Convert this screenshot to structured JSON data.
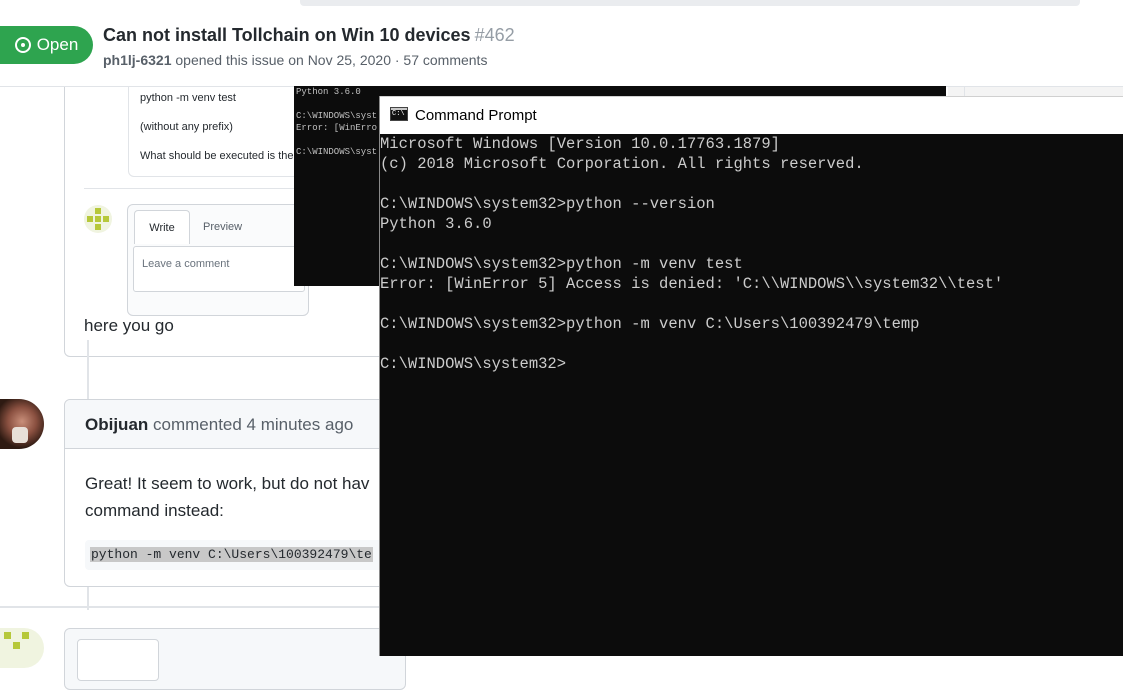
{
  "issue": {
    "state": "Open",
    "title": "Can not install Tollchain on Win 10 devices",
    "number": "#462",
    "author": "ph1lj-6321",
    "meta": "opened this issue on Nov 25, 2020 · 57 comments"
  },
  "previous_comment": {
    "lines": [
      "python -m venv test",
      "(without any prefix)",
      "What should be executed is the"
    ],
    "tabs": [
      "Write",
      "Preview"
    ],
    "comment_placeholder": "Leave a comment",
    "reply_text": "here you go"
  },
  "comment": {
    "author": "Obijuan",
    "action": "commented 4 minutes ago",
    "body_lines": [
      "Great! It seem to work, but do not hav",
      "command instead:"
    ],
    "code": "python -m venv C:\\Users\\100392479\\te"
  },
  "background_console": {
    "lines": [
      "Python 3.6.0",
      "",
      "C:\\WINDOWS\\syst",
      "Error: [WinErro",
      "",
      "C:\\WINDOWS\\syst"
    ]
  },
  "cmd": {
    "title": "Command Prompt",
    "lines": [
      "Microsoft Windows [Version 10.0.17763.1879]",
      "(c) 2018 Microsoft Corporation. All rights reserved.",
      "",
      "C:\\WINDOWS\\system32>python --version",
      "Python 3.6.0",
      "",
      "C:\\WINDOWS\\system32>python -m venv test",
      "Error: [WinError 5] Access is denied: 'C:\\\\WINDOWS\\\\system32\\\\test'",
      "",
      "C:\\WINDOWS\\system32>python -m venv C:\\Users\\100392479\\temp",
      "",
      "C:\\WINDOWS\\system32>"
    ]
  },
  "colors": {
    "open_badge": "#2ea44f",
    "console_bg": "#0c0c0c",
    "console_text": "#cccccc"
  }
}
